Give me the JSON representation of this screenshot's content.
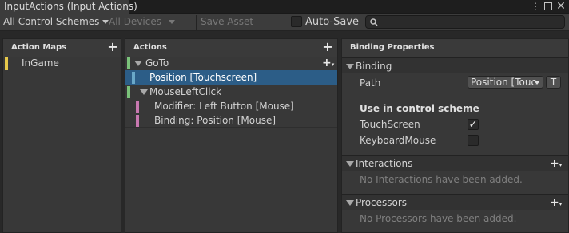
{
  "window": {
    "tab_title": "InputActions (Input Actions)",
    "menu_icon": "menu-dots-icon",
    "maximize_icon": "maximize-icon",
    "close_icon": "close-icon"
  },
  "toolbar": {
    "control_scheme": "All Control Schemes",
    "devices": "All Devices",
    "save_asset": "Save Asset",
    "auto_save_label": "Auto-Save",
    "auto_save_checked": false,
    "search_value": "",
    "search_icon": "search-icon"
  },
  "action_maps": {
    "header": "Action Maps",
    "items": [
      {
        "label": "InGame",
        "color": "#e6c84a"
      }
    ]
  },
  "actions": {
    "header": "Actions",
    "items": [
      {
        "label": "GoTo",
        "kind": "action",
        "color": "#7ac27a",
        "expanded": true
      },
      {
        "label": "Position [Touchscreen]",
        "kind": "binding",
        "color": "#6aa8c8",
        "selected": true
      },
      {
        "label": "MouseLeftClick",
        "kind": "action",
        "color": "#7ac27a",
        "expanded": true
      },
      {
        "label": "Modifier: Left Button [Mouse]",
        "kind": "part",
        "color": "#c878b0"
      },
      {
        "label": "Binding: Position [Mouse]",
        "kind": "part",
        "color": "#c878b0"
      }
    ]
  },
  "properties": {
    "header": "Binding Properties",
    "binding_section": "Binding",
    "path_label": "Path",
    "path_value": "Position [Touc",
    "path_t_button": "T",
    "scheme_heading": "Use in control scheme",
    "schemes": [
      {
        "label": "TouchScreen",
        "checked": true
      },
      {
        "label": "KeyboardMouse",
        "checked": false
      }
    ],
    "interactions_section": "Interactions",
    "interactions_empty": "No Interactions have been added.",
    "processors_section": "Processors",
    "processors_empty": "No Processors have been added."
  },
  "colors": {
    "selection": "#2c5d87",
    "background": "#282828",
    "panel": "#383838"
  }
}
